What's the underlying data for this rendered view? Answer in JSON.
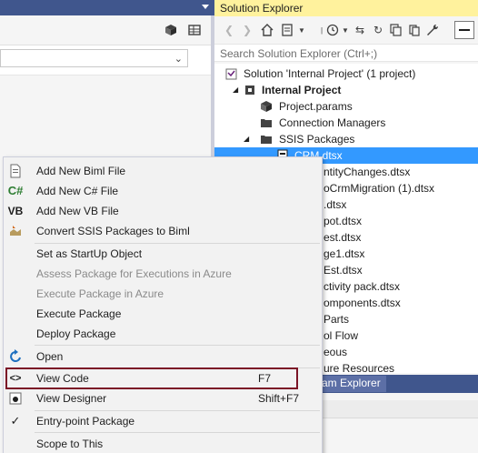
{
  "solution_explorer": {
    "title": "Solution Explorer",
    "search_placeholder": "Search Solution Explorer (Ctrl+;)",
    "toolbar_icons": [
      "back-icon",
      "forward-icon",
      "home-icon",
      "collection-icon",
      "dropdown-icon",
      "history-icon",
      "sync-icon",
      "refresh-icon",
      "copy-icon",
      "properties-icon",
      "wrench-icon",
      "pin-icon"
    ],
    "tree": [
      {
        "label": "Solution 'Internal Project' (1 project)",
        "bold": false,
        "icon": "solution-icon"
      },
      {
        "label": "Internal Project",
        "bold": true,
        "icon": "project-icon"
      },
      {
        "label": "Project.params",
        "bold": false,
        "icon": "params-icon"
      },
      {
        "label": "Connection Managers",
        "bold": false,
        "icon": "folder-icon"
      },
      {
        "label": "SSIS Packages",
        "bold": false,
        "icon": "folder-icon"
      },
      {
        "label": "CRM.dtsx",
        "bold": false,
        "icon": "package-icon",
        "selected": true
      },
      {
        "label": "ntityChanges.dtsx"
      },
      {
        "label": "oCrmMigration (1).dtsx"
      },
      {
        "label": ".dtsx"
      },
      {
        "label": "pot.dtsx"
      },
      {
        "label": "est.dtsx"
      },
      {
        "label": "ge1.dtsx"
      },
      {
        "label": "Est.dtsx"
      },
      {
        "label": "ctivity pack.dtsx"
      },
      {
        "label": "omponents.dtsx"
      },
      {
        "label": "Parts"
      },
      {
        "label": "ol Flow"
      },
      {
        "label": "eous"
      },
      {
        "label": "ure Resources"
      }
    ],
    "bottom_tab": "am Explorer"
  },
  "context_menu": {
    "items": [
      {
        "label": "Add New Biml File",
        "icon": "biml-file-icon",
        "icon_text": "",
        "shortcut": "",
        "disabled": false
      },
      {
        "label": "Add New C# File",
        "icon": "csharp-icon",
        "icon_text": "C#",
        "shortcut": "",
        "disabled": false
      },
      {
        "label": "Add New VB File",
        "icon": "vb-icon",
        "icon_text": "VB",
        "shortcut": "",
        "disabled": false
      },
      {
        "label": "Convert SSIS Packages to Biml",
        "icon": "convert-icon",
        "icon_text": "",
        "shortcut": "",
        "disabled": false
      },
      {
        "label": "Set as StartUp Object",
        "icon": "",
        "icon_text": "",
        "shortcut": "",
        "disabled": false
      },
      {
        "label": "Assess Package for Executions in Azure",
        "icon": "",
        "icon_text": "",
        "shortcut": "",
        "disabled": true
      },
      {
        "label": "Execute Package in Azure",
        "icon": "",
        "icon_text": "",
        "shortcut": "",
        "disabled": true
      },
      {
        "label": "Execute Package",
        "icon": "",
        "icon_text": "",
        "shortcut": "",
        "disabled": false
      },
      {
        "label": "Deploy Package",
        "icon": "",
        "icon_text": "",
        "shortcut": "",
        "disabled": false
      },
      {
        "label": "Open",
        "icon": "open-icon",
        "icon_text": "",
        "shortcut": "",
        "disabled": false
      },
      {
        "label": "View Code",
        "icon": "code-icon",
        "icon_text": "<>",
        "shortcut": "F7",
        "disabled": false,
        "highlighted": true
      },
      {
        "label": "View Designer",
        "icon": "designer-icon",
        "icon_text": "",
        "shortcut": "Shift+F7",
        "disabled": false
      },
      {
        "label": "Entry-point Package",
        "icon": "checkmark-icon",
        "icon_text": "✓",
        "shortcut": "",
        "disabled": false
      },
      {
        "label": "Scope to This",
        "icon": "",
        "icon_text": "",
        "shortcut": "",
        "disabled": false
      }
    ]
  },
  "colors": {
    "title_bar": "#40568d",
    "se_title_bg": "#fff29d",
    "selection": "#3399ff",
    "highlight_border": "#7b1426"
  }
}
